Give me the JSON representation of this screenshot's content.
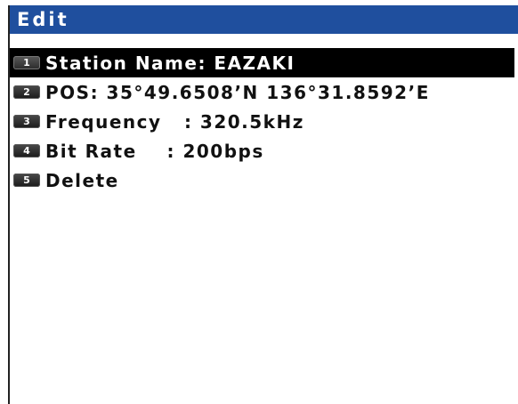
{
  "title": "Edit",
  "menu": {
    "items": [
      {
        "key": "1",
        "label": "Station Name: EAZAKI",
        "selected": true
      },
      {
        "key": "2",
        "label": "POS: 35°49.6508’N 136°31.8592’E",
        "selected": false
      },
      {
        "key": "3",
        "label": "Frequency   : 320.5kHz",
        "selected": false
      },
      {
        "key": "4",
        "label": "Bit Rate    : 200bps",
        "selected": false
      },
      {
        "key": "5",
        "label": "Delete",
        "selected": false
      }
    ]
  },
  "colors": {
    "title_bar": "#1f4f9e",
    "selected_row": "#000000",
    "key_badge": "#2a2a2a"
  }
}
